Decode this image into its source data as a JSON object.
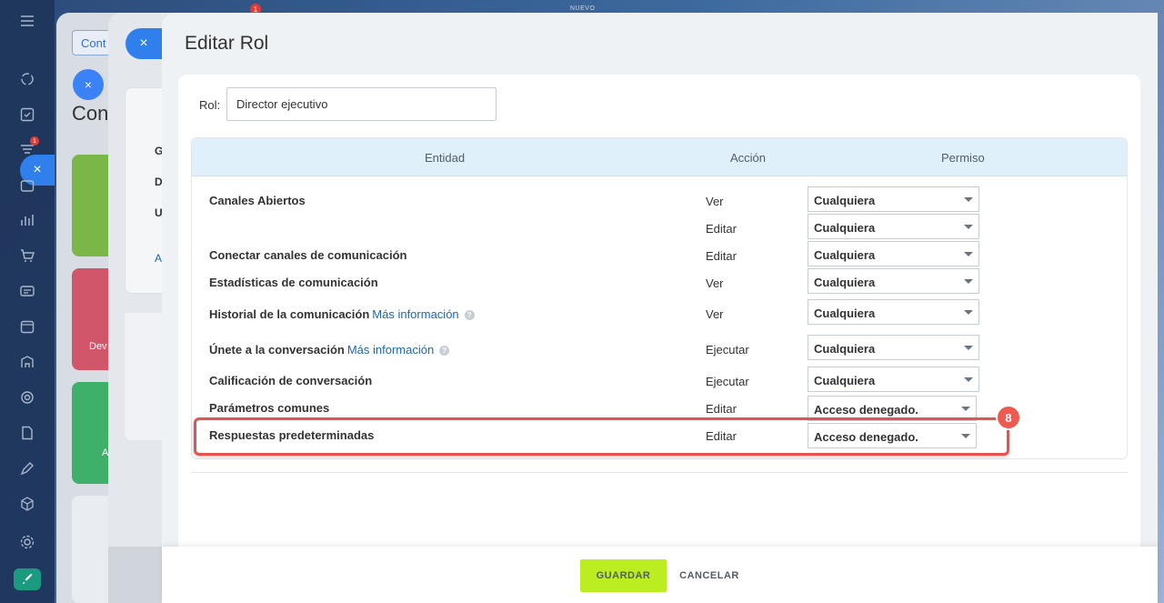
{
  "top_bar": {
    "badge_count": "1",
    "new_label": "NUEVO"
  },
  "sidebar": {
    "icons": [
      "menu-icon",
      "sync-icon",
      "check-square-icon",
      "filter-icon",
      "inbox-icon",
      "bar-chart-icon",
      "cart-icon",
      "contact-card-icon",
      "calendar-icon",
      "building-icon",
      "target-icon",
      "document-edit-icon",
      "pen-icon",
      "cube-icon",
      "gear-icon",
      "rocket-icon"
    ],
    "filter_badge": "1",
    "close_symbol": "×"
  },
  "background": {
    "tab_label": "Cont",
    "title": "Con",
    "card_letters": [
      "G",
      "D",
      "U"
    ],
    "card_link": "A",
    "tile_labels": [
      "Dev",
      "A"
    ],
    "tile_colors": [
      "#7ab648",
      "#d1566a",
      "#3fb06a",
      "#e9edf2"
    ],
    "close_symbol": "×"
  },
  "dialog": {
    "close_symbol": "×",
    "title": "Editar Rol",
    "role_label": "Rol:",
    "role_value": "Director ejecutivo",
    "columns": {
      "entity": "Entidad",
      "action": "Acción",
      "permission": "Permiso"
    },
    "rows": [
      {
        "entity": "Canales Abiertos",
        "more": "",
        "action": "Ver",
        "permission": "Cualquiera"
      },
      {
        "entity": "",
        "more": "",
        "action": "Editar",
        "permission": "Cualquiera"
      },
      {
        "entity": "Conectar canales de comunicación",
        "more": "",
        "action": "Editar",
        "permission": "Cualquiera"
      },
      {
        "entity": "Estadísticas de comunicación",
        "more": "",
        "action": "Ver",
        "permission": "Cualquiera"
      },
      {
        "entity": "Historial de la comunicación",
        "more": "Más información",
        "action": "Ver",
        "permission": "Cualquiera"
      },
      {
        "entity": "Únete a la conversación",
        "more": "Más información",
        "action": "Ejecutar",
        "permission": "Cualquiera"
      },
      {
        "entity": "Calificación de conversación",
        "more": "",
        "action": "Ejecutar",
        "permission": "Cualquiera"
      },
      {
        "entity": "Parámetros comunes",
        "more": "",
        "action": "Editar",
        "permission": "Acceso denegado."
      },
      {
        "entity": "Respuestas predeterminadas",
        "more": "",
        "action": "Editar",
        "permission": "Acceso denegado."
      }
    ],
    "help_symbol": "?",
    "step_badge": "8",
    "highlight_color": "#e4534f"
  },
  "footer": {
    "save_label": "GUARDAR",
    "cancel_label": "CANCELAR"
  }
}
